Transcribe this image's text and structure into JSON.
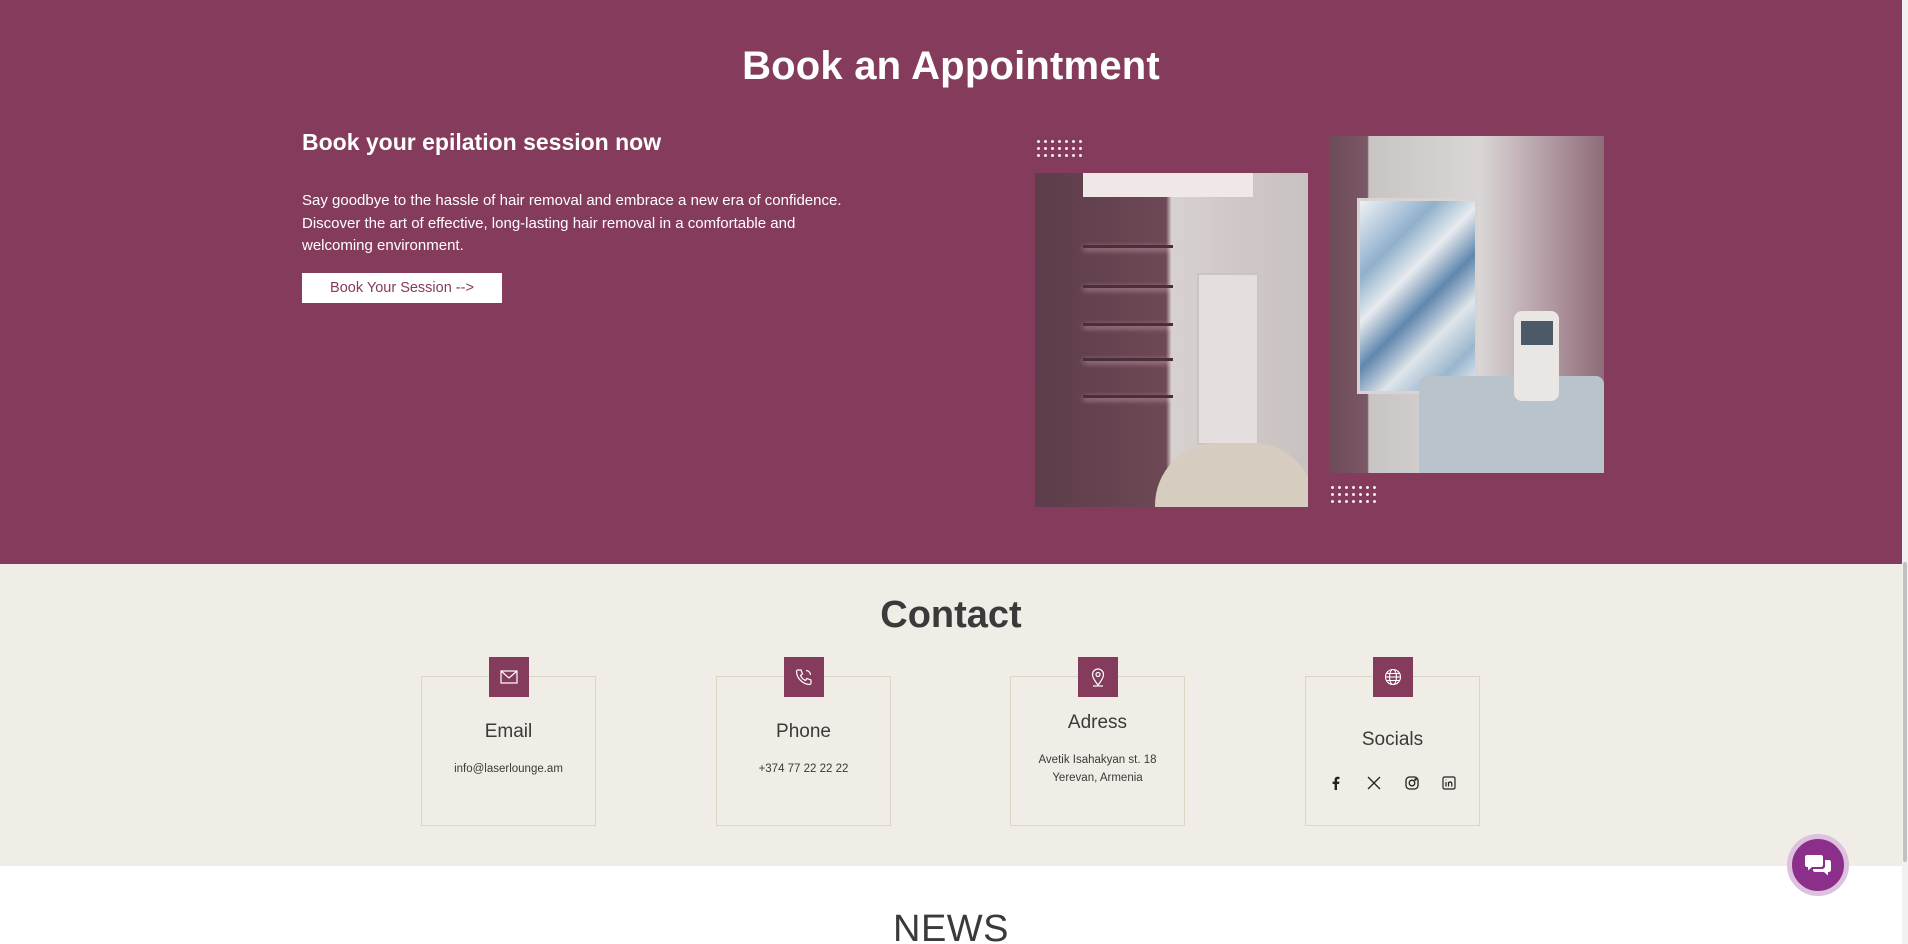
{
  "booking": {
    "title": "Book an Appointment",
    "subtitle": "Book your epilation session now",
    "description": "Say goodbye to the hassle of hair removal and embrace a new era of confidence. Discover the art of effective, long-lasting hair removal in a comfortable and welcoming environment.",
    "button_label": "Book Your Session -->"
  },
  "contact": {
    "title": "Contact",
    "email": {
      "label": "Email",
      "value": "info@laserlounge.am",
      "icon": "envelope-icon"
    },
    "phone": {
      "label": "Phone",
      "value": "+374 77 22 22 22",
      "icon": "phone-icon"
    },
    "address": {
      "label": "Adress",
      "line1": "Avetik Isahakyan st. 18",
      "line2": "Yerevan, Armenia",
      "icon": "map-pin-icon"
    },
    "socials": {
      "label": "Socials",
      "icon": "globe-icon",
      "items": [
        "facebook-icon",
        "x-icon",
        "instagram-icon",
        "linkedin-icon"
      ]
    }
  },
  "news": {
    "title": "NEWS"
  },
  "colors": {
    "brand": "#853b5c",
    "contact_bg": "#f0ede6",
    "chat": "#8b2f8a"
  }
}
